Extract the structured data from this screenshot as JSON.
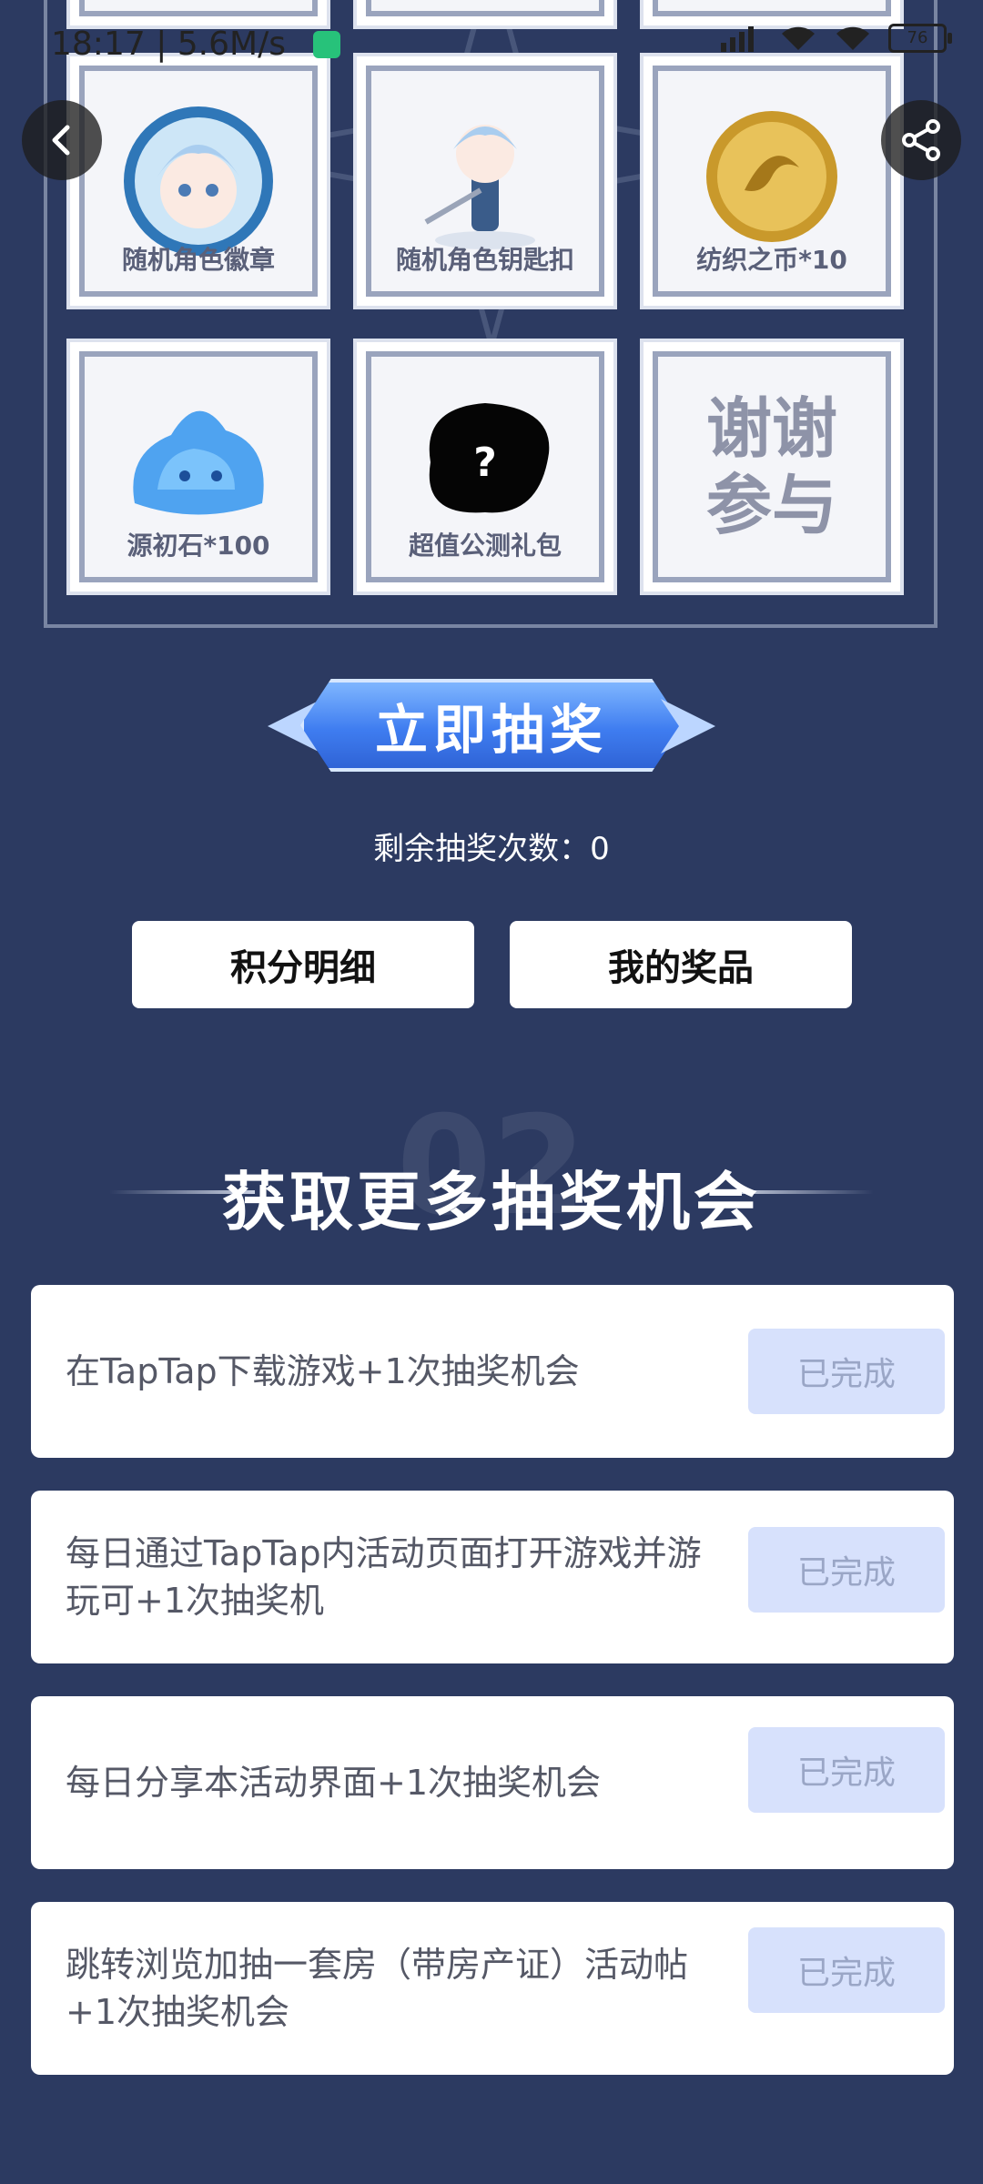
{
  "status_bar": {
    "time": "18:17 | 5.6M/s",
    "battery": "76"
  },
  "prizes": [
    {
      "label": "随机角色徽章",
      "icon": "character-badge-icon"
    },
    {
      "label": "随机角色钥匙扣",
      "icon": "character-keychain-icon"
    },
    {
      "label": "纺织之币*10",
      "icon": "gold-coin-icon"
    },
    {
      "label": "源初石*100",
      "icon": "blue-slime-crystal-icon"
    },
    {
      "label": "超值公测礼包",
      "icon": "mystery-gift-icon"
    },
    {
      "label": "谢谢参与",
      "icon": "thanks-text"
    }
  ],
  "draw": {
    "button_label": "立即抽奖",
    "remaining_text": "剩余抽奖次数：0"
  },
  "actions": {
    "points_detail": "积分明细",
    "my_prizes": "我的奖品"
  },
  "section": {
    "number": "02",
    "title": "获取更多抽奖机会"
  },
  "tasks": [
    {
      "text": "在TapTap下载游戏+1次抽奖机会",
      "status": "已完成"
    },
    {
      "text": "每日通过TapTap内活动页面打开游戏并游玩可+1次抽奖机",
      "status": "已完成"
    },
    {
      "text": "每日分享本活动界面+1次抽奖机会",
      "status": "已完成"
    },
    {
      "text": "跳转浏览加抽一套房（带房产证）活动帖+1次抽奖机会",
      "status": "已完成"
    }
  ],
  "colors": {
    "background": "#2c3a61",
    "accent_blue": "#3f7df0",
    "done_button": "#d7e1fc"
  }
}
